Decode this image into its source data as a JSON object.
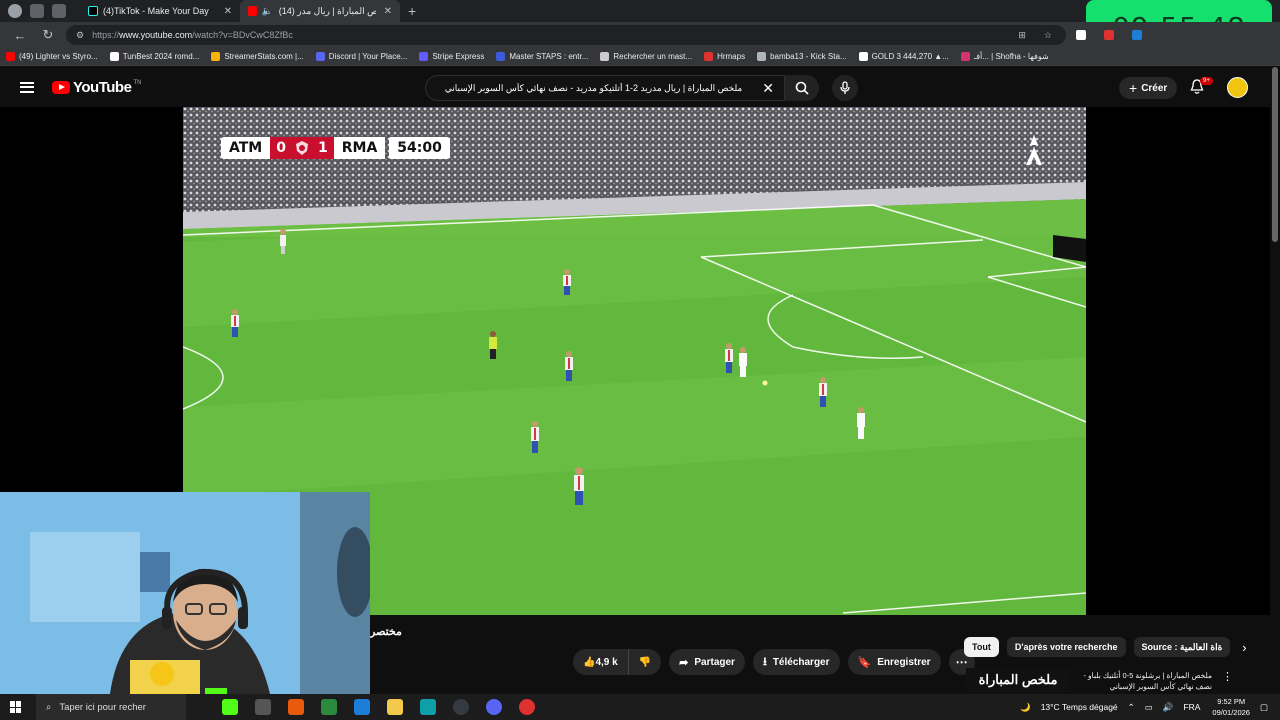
{
  "browser": {
    "tabs": [
      {
        "title": "(4)TikTok - Make Your Day",
        "active": false
      },
      {
        "title": "ملخص المباراة | ريال مدر (14)",
        "active": true
      }
    ],
    "url_prefix": "https://",
    "url_host": "www.youtube.com",
    "url_path": "/watch?v=BDvCwC8ZfBc",
    "bookmarks": [
      {
        "label": "(49) Lighter vs Styro...",
        "color": "#ff0000"
      },
      {
        "label": "TunBest 2024 romd...",
        "color": "#ffffff"
      },
      {
        "label": "StreamerStats.com |...",
        "color": "#f4b400"
      },
      {
        "label": "Discord | Your Place...",
        "color": "#5865f2"
      },
      {
        "label": "Stripe Express",
        "color": "#635bff"
      },
      {
        "label": "Master STAPS : entr...",
        "color": "#3b5bdb"
      },
      {
        "label": "Rechercher un mast...",
        "color": "#cccccc"
      },
      {
        "label": "Hrmaps",
        "color": "#e03131"
      },
      {
        "label": "bamba13 - Kick Sta...",
        "color": "#adb5bd"
      },
      {
        "label": "GOLD 3 444,270 ▲...",
        "color": "#ffffff"
      },
      {
        "label": "أفـ... | Shofha - شوفها",
        "color": "#d6336c"
      }
    ]
  },
  "overlay_clock": "09:55:48",
  "youtube": {
    "logo_text": "YouTube",
    "logo_superscript": "TN",
    "search_query": "ملخص المباراة | ريال مدريد 2-1 أتلتيكو مدريد - نصف نهائي كأس السوبر الإسباني",
    "create_label": "Créer",
    "notif_badge": "9+",
    "scoreboard": {
      "home": "ATM",
      "home_score": "0",
      "away_score": "1",
      "away": "RMA",
      "time": "54:00"
    },
    "title_fragment": "مختصر",
    "actions": {
      "likes": "4,9 k",
      "share": "Partager",
      "download": "Télécharger",
      "save": "Enregistrer"
    },
    "chips": [
      "Tout",
      "D'après votre recherche",
      "Source : ةاة العالمية"
    ],
    "rec_title": "ملخص المباراة | برشلونة 5-0 أتلتيك بلباو - نصف نهائي كأس السوبر الإسباني",
    "rec_thumb_text": "ملخص المباراة"
  },
  "taskbar": {
    "search_placeholder": "Taper ici pour recher",
    "weather": "13°C  Temps dégagé",
    "lang": "FRA",
    "time": "9:52 PM",
    "date": "09/01/2026"
  }
}
